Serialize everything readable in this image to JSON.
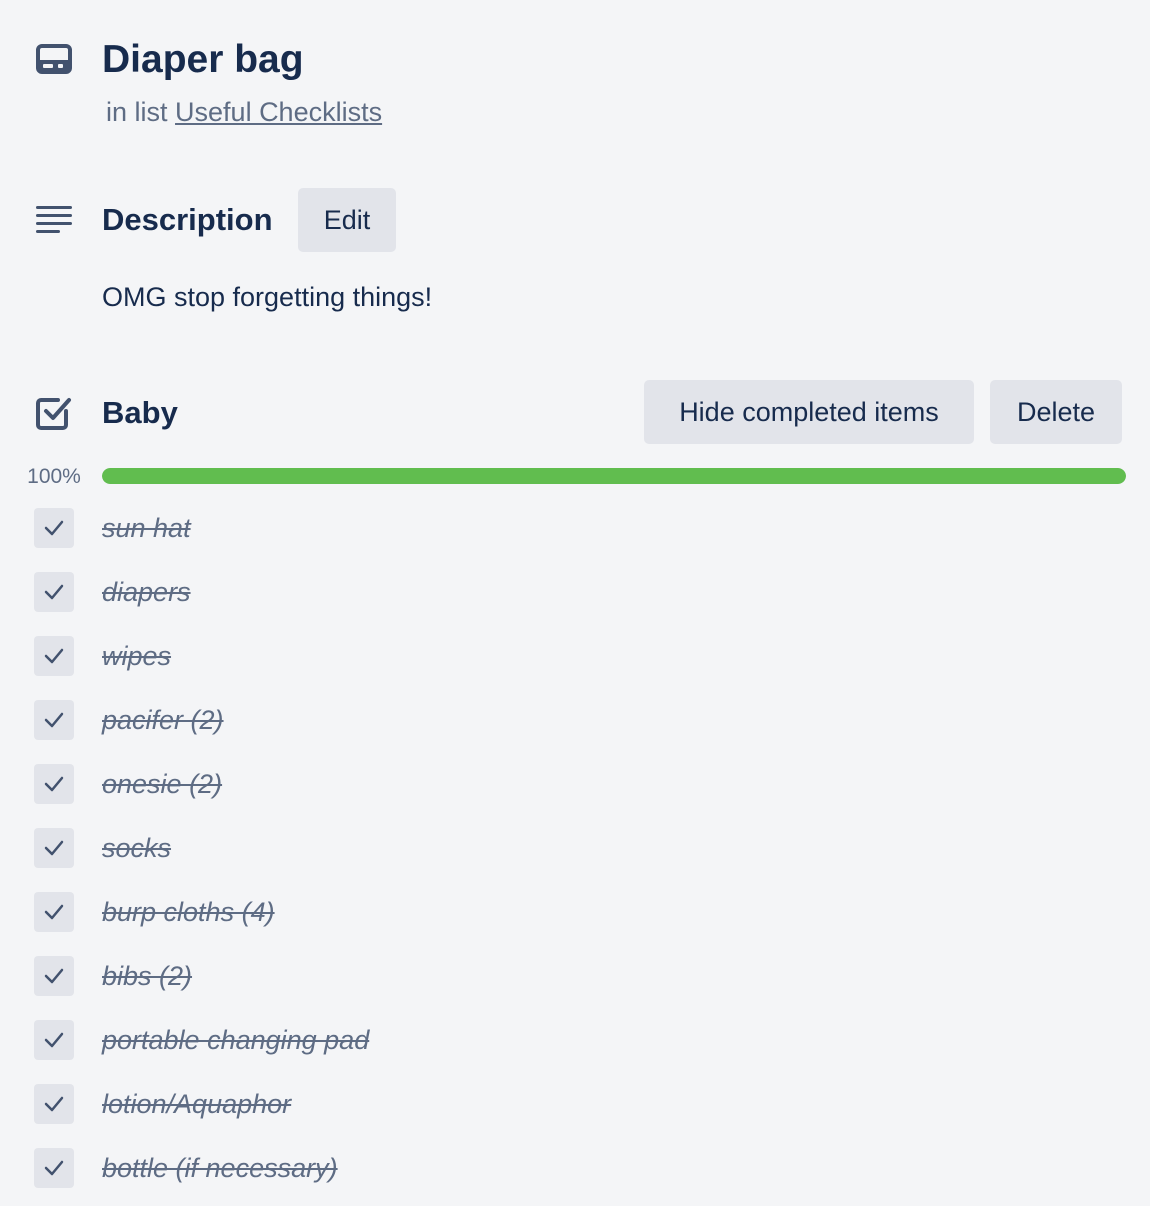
{
  "card": {
    "title": "Diaper bag",
    "in_list_prefix": "in list",
    "list_name": "Useful Checklists"
  },
  "description": {
    "heading": "Description",
    "edit_label": "Edit",
    "text": "OMG stop forgetting things!"
  },
  "checklist": {
    "title": "Baby",
    "hide_completed_label": "Hide completed items",
    "delete_label": "Delete",
    "progress_label": "100%",
    "progress_fraction": 1.0,
    "progress_color": "#61bd4f",
    "items": [
      {
        "label": "sun hat",
        "checked": true
      },
      {
        "label": "diapers",
        "checked": true
      },
      {
        "label": "wipes",
        "checked": true
      },
      {
        "label": "pacifer (2)",
        "checked": true
      },
      {
        "label": "onesie (2)",
        "checked": true
      },
      {
        "label": "socks",
        "checked": true
      },
      {
        "label": "burp cloths (4)",
        "checked": true
      },
      {
        "label": "bibs (2)",
        "checked": true
      },
      {
        "label": "portable changing pad",
        "checked": true
      },
      {
        "label": "lotion/Aquaphor",
        "checked": true
      },
      {
        "label": "bottle (if necessary)",
        "checked": true
      }
    ]
  },
  "icons": {
    "card": "card-icon",
    "description": "description-lines-icon",
    "checklist": "checklist-icon",
    "item_check": "checkmark-icon"
  }
}
